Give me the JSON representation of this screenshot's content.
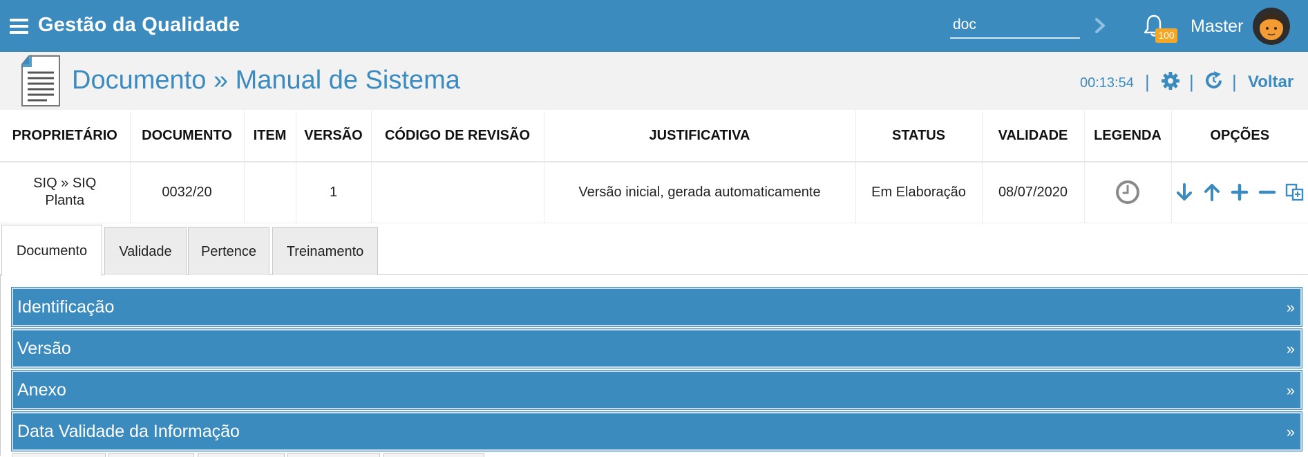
{
  "app": {
    "title": "Gestão da Qualidade"
  },
  "search": {
    "value": "doc"
  },
  "notifications": {
    "count": "100"
  },
  "user": {
    "name": "Master"
  },
  "page": {
    "title": "Documento » Manual de Sistema",
    "timer": "00:13:54",
    "back_label": "Voltar"
  },
  "table": {
    "headers": [
      "PROPRIETÁRIO",
      "DOCUMENTO",
      "ITEM",
      "VERSÃO",
      "CÓDIGO DE REVISÃO",
      "JUSTIFICATIVA",
      "STATUS",
      "VALIDADE",
      "LEGENDA",
      "OPÇÕES"
    ],
    "row": {
      "proprietario": "SIQ » SIQ Planta",
      "documento": "0032/20",
      "item": "",
      "versao": "1",
      "codigo_revisao": "",
      "justificativa": "Versão inicial, gerada automaticamente",
      "status": "Em Elaboração",
      "validade": "08/07/2020"
    },
    "legend_icon": "clock-icon",
    "options_icons": [
      "arrow-down-icon",
      "arrow-up-icon",
      "plus-icon",
      "minus-icon",
      "copy-icon"
    ]
  },
  "tabs": [
    "Documento",
    "Validade",
    "Pertence",
    "Treinamento"
  ],
  "active_tab": "Documento",
  "sections": [
    {
      "title": "Identificação",
      "arrow": "»"
    },
    {
      "title": "Versão",
      "arrow": "»"
    },
    {
      "title": "Anexo",
      "arrow": "»"
    },
    {
      "title": "Data Validade da Informação",
      "arrow": "»"
    }
  ],
  "colors": {
    "primary": "#3b8bbe",
    "badge": "#f5a623",
    "header_bg": "#f2f2f2"
  }
}
